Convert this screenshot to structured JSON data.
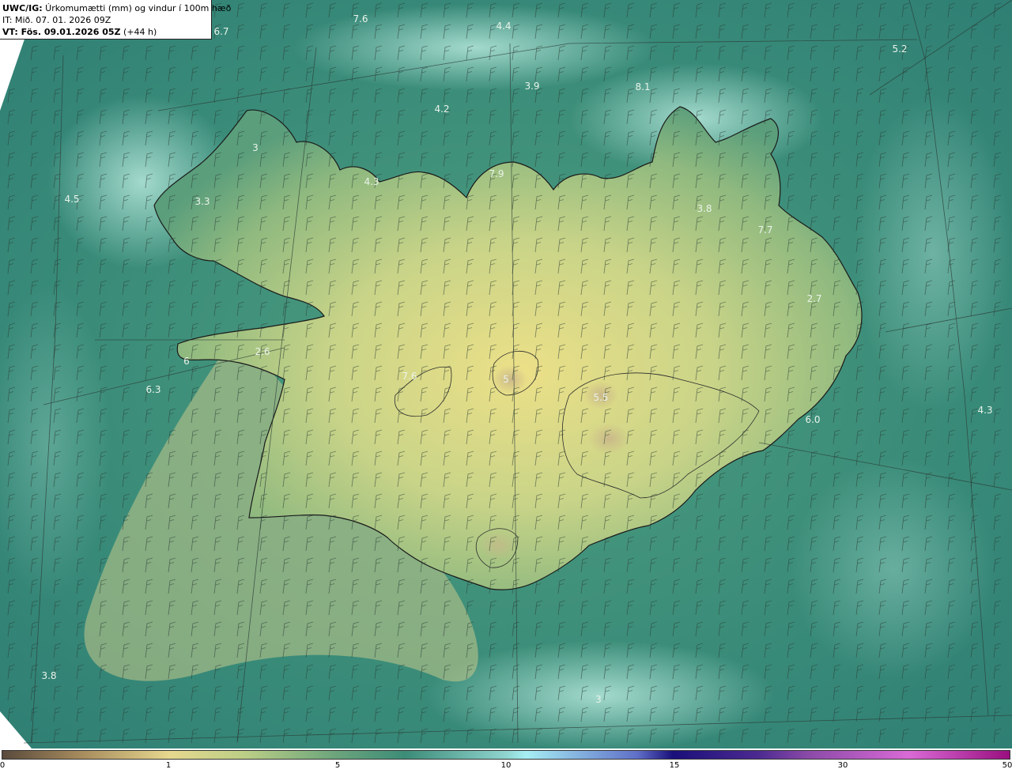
{
  "header": {
    "product": "UWC/IG:",
    "title": " Úrkomumætti (mm) og vindur í 100m hæð",
    "it_line": "IT: Mið. 07. 01. 2026 09Z",
    "vt_label": "VT: Fös. 09.01.2026 05Z",
    "vt_suffix": " (+44 h)"
  },
  "map_labels": [
    "6.7",
    "7.6",
    "4.4",
    "5.2",
    "3.9",
    "4.2",
    "8.1",
    "4.5",
    "3.3",
    "3",
    "4.3",
    "7.9",
    "3.8",
    "7.7",
    "2.7",
    "2.6",
    "6.0",
    "6.3",
    "6",
    "7.6",
    "4.3",
    "3.8",
    "5.5",
    "5",
    "3"
  ],
  "colorbar": {
    "ticks": [
      "0",
      "1",
      "5",
      "10",
      "15",
      "30",
      "50"
    ],
    "colors": {
      "dry": "#5a4a3c",
      "low": "#e6d88e",
      "mid": "#3c8c78",
      "high": "#a6eef4",
      "very_high": "#1a0f7a",
      "extreme": "#9a0f80"
    }
  },
  "colors": {
    "sea_base": "#3f8f79",
    "land_low": "#d8d88a",
    "coastline": "#1a1a1a"
  }
}
